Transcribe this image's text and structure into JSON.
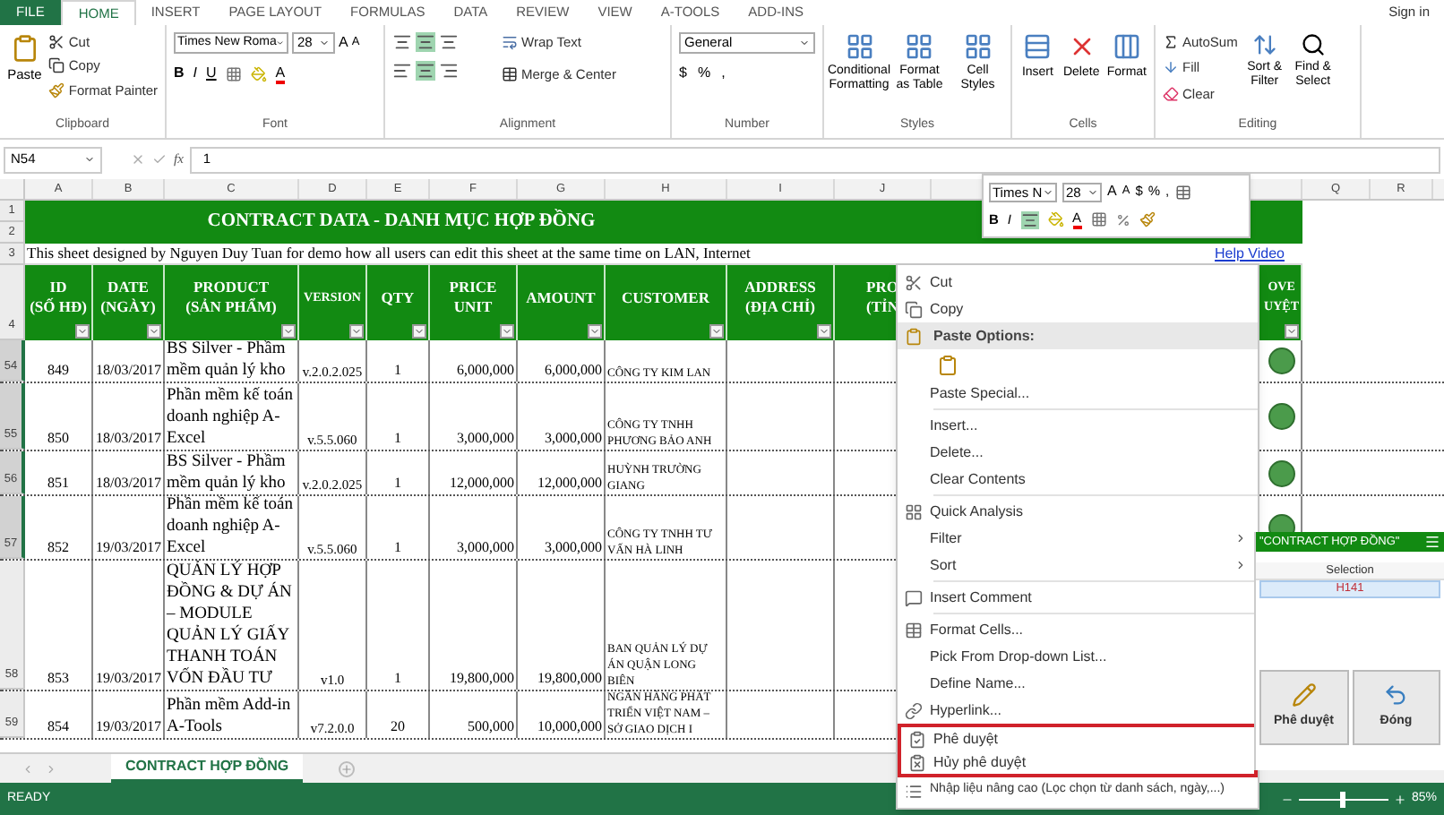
{
  "ribbon_tabs": [
    {
      "label": "FILE",
      "kind": "file",
      "selected": false
    },
    {
      "label": "HOME",
      "kind": "tab",
      "selected": true
    },
    {
      "label": "INSERT",
      "kind": "tab",
      "selected": false
    },
    {
      "label": "PAGE LAYOUT",
      "kind": "tab",
      "selected": false
    },
    {
      "label": "FORMULAS",
      "kind": "tab",
      "selected": false
    },
    {
      "label": "DATA",
      "kind": "tab",
      "selected": false
    },
    {
      "label": "REVIEW",
      "kind": "tab",
      "selected": false
    },
    {
      "label": "VIEW",
      "kind": "tab",
      "selected": false
    },
    {
      "label": "A-TOOLS",
      "kind": "tab",
      "selected": false
    },
    {
      "label": "ADD-INS",
      "kind": "tab",
      "selected": false
    }
  ],
  "sign_in": "Sign in",
  "ribbon": {
    "clipboard": {
      "paste": "Paste",
      "cut": "Cut",
      "copy": "Copy",
      "format_painter": "Format Painter",
      "label": "Clipboard"
    },
    "font": {
      "name": "Times New Roma",
      "size": "28",
      "grow": "A",
      "shrink": "A",
      "bold": "B",
      "italic": "I",
      "underline": "U",
      "font_color": "A",
      "label": "Font"
    },
    "alignment": {
      "wrap_text": "Wrap Text",
      "merge": "Merge & Center",
      "label": "Alignment"
    },
    "number": {
      "format": "General",
      "currency": "$",
      "percent": "%",
      "comma": ",",
      "label": "Number"
    },
    "styles": {
      "buttons": [
        "Conditional Formatting",
        "Format as Table",
        "Cell Styles"
      ],
      "label": "Styles"
    },
    "cells": {
      "buttons": [
        "Insert",
        "Delete",
        "Format"
      ],
      "label": "Cells"
    },
    "editing": {
      "autosum": "AutoSum",
      "fill": "Fill",
      "clear": "Clear",
      "sort": "Sort & Filter",
      "find": "Find & Select",
      "label": "Editing"
    }
  },
  "formula_bar": {
    "name_box": "N54",
    "function_label": "fx",
    "value": "1"
  },
  "column_headers": [
    "A",
    "B",
    "C",
    "D",
    "E",
    "F",
    "G",
    "H",
    "I",
    "J",
    "Q",
    "R"
  ],
  "sheet": {
    "title_rows": [
      "1",
      "2"
    ],
    "title": "CONTRACT DATA - DANH MỤC HỢP ĐỒNG",
    "note_row": "3",
    "note": "This sheet designed by Nguyen Duy Tuan for demo how all users can edit this sheet at the same time on LAN, Internet",
    "help_link": "Help Video",
    "header_row": "4",
    "headers": [
      "ID\n(SỐ HĐ)",
      "DATE\n(NGÀY)",
      "PRODUCT\n(SẢN PHẨM)",
      "VERSION",
      "QTY",
      "PRICE UNIT",
      "AMOUNT",
      "CUSTOMER",
      "ADDRESS\n(ĐỊA CHỈ)",
      "PRO\n(TỈN"
    ],
    "approve_header": "OVE\nUYỆT",
    "rows": [
      {
        "row": "54",
        "selected": true,
        "approved": true,
        "cells": [
          "849",
          "18/03/2017",
          "BS Silver - Phầm mềm quản lý kho",
          "v.2.0.2.025",
          "1",
          "6,000,000",
          "6,000,000",
          "CÔNG TY KIM LAN"
        ]
      },
      {
        "row": "55",
        "selected": true,
        "approved": true,
        "cells": [
          "850",
          "18/03/2017",
          "Phần mềm kế toán doanh nghiệp A-Excel",
          "v.5.5.060",
          "1",
          "3,000,000",
          "3,000,000",
          "CÔNG TY TNHH PHƯƠNG BẢO ANH"
        ]
      },
      {
        "row": "56",
        "selected": true,
        "approved": true,
        "cells": [
          "851",
          "18/03/2017",
          "BS Silver - Phầm mềm quản lý kho",
          "v.2.0.2.025",
          "1",
          "12,000,000",
          "12,000,000",
          "HUỲNH TRƯỜNG GIANG"
        ]
      },
      {
        "row": "57",
        "selected": true,
        "approved": true,
        "cells": [
          "852",
          "19/03/2017",
          "Phần mềm kế toán doanh nghiệp A-Excel",
          "v.5.5.060",
          "1",
          "3,000,000",
          "3,000,000",
          "CÔNG TY TNHH TƯ VẤN HÀ LINH"
        ]
      },
      {
        "row": "58",
        "selected": false,
        "approved": false,
        "cells": [
          "853",
          "19/03/2017",
          "QUẢN LÝ HỢP ĐỒNG & DỰ ÁN – MODULE QUẢN LÝ GIẤY THANH TOÁN VỐN ĐẦU TƯ",
          "v1.0",
          "1",
          "19,800,000",
          "19,800,000",
          "BAN QUẢN LÝ DỰ ÁN QUẬN LONG BIÊN"
        ]
      },
      {
        "row": "59",
        "selected": false,
        "approved": false,
        "cells": [
          "854",
          "19/03/2017",
          "Phần mềm Add-in A-Tools",
          "v7.2.0.0",
          "20",
          "500,000",
          "10,000,000",
          "NGÂN HÀNG PHÁT TRIỂN VIỆT NAM – SỞ GIAO DỊCH I"
        ]
      }
    ]
  },
  "sheet_tabs": [
    {
      "label": "CONTRACT HỢP ĐỒNG",
      "selected": true
    }
  ],
  "status_bar": {
    "mode": "READY",
    "zoom_slider": {
      "level": 0.5
    },
    "zoom": "85%"
  },
  "mini_toolbar": {
    "font": "Times N",
    "size": "28",
    "grow": "A",
    "shrink": "A",
    "currency": "$",
    "percent": "%",
    "comma": ",",
    "bold": "B",
    "italic": "I",
    "font_color": "A"
  },
  "context_menu": [
    {
      "kind": "item",
      "label": "Cut",
      "submenu": false,
      "boxed": false
    },
    {
      "kind": "item",
      "label": "Copy",
      "submenu": false,
      "boxed": false
    },
    {
      "kind": "header",
      "label": "Paste Options:"
    },
    {
      "kind": "paste-option"
    },
    {
      "kind": "item",
      "label": "Paste Special...",
      "submenu": false,
      "boxed": false
    },
    {
      "kind": "separator"
    },
    {
      "kind": "item",
      "label": "Insert...",
      "submenu": false,
      "boxed": false
    },
    {
      "kind": "item",
      "label": "Delete...",
      "submenu": false,
      "boxed": false
    },
    {
      "kind": "item",
      "label": "Clear Contents",
      "submenu": false,
      "boxed": false
    },
    {
      "kind": "separator"
    },
    {
      "kind": "item",
      "label": "Quick Analysis",
      "submenu": false,
      "boxed": false
    },
    {
      "kind": "item",
      "label": "Filter",
      "submenu": true,
      "boxed": false
    },
    {
      "kind": "item",
      "label": "Sort",
      "submenu": true,
      "boxed": false
    },
    {
      "kind": "separator"
    },
    {
      "kind": "item",
      "label": "Insert Comment",
      "submenu": false,
      "boxed": false
    },
    {
      "kind": "separator"
    },
    {
      "kind": "item",
      "label": "Format Cells...",
      "submenu": false,
      "boxed": false
    },
    {
      "kind": "item",
      "label": "Pick From Drop-down List...",
      "submenu": false,
      "boxed": false
    },
    {
      "kind": "item",
      "label": "Define Name...",
      "submenu": false,
      "boxed": false
    },
    {
      "kind": "item",
      "label": "Hyperlink...",
      "submenu": false,
      "boxed": false
    },
    {
      "kind": "item",
      "label": "Phê duyệt",
      "submenu": false,
      "boxed": true
    },
    {
      "kind": "item",
      "label": "Hủy phê duyệt",
      "submenu": false,
      "boxed": true
    },
    {
      "kind": "item",
      "label": "Nhập liệu nâng cao (Lọc chọn từ danh sách, ngày,...)",
      "submenu": false,
      "boxed": false
    }
  ],
  "task_pane": {
    "title": "\"CONTRACT HỢP ĐỒNG\"",
    "column": "Selection",
    "value": "H141",
    "buttons": [
      "Phê duyệt",
      "Đóng"
    ]
  }
}
